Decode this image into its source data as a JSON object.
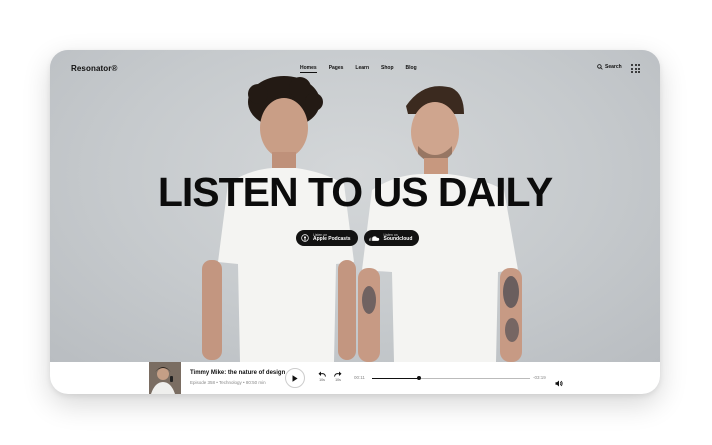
{
  "header": {
    "logo": "Resonator®",
    "nav": [
      "Homes",
      "Pages",
      "Learn",
      "Shop",
      "Blog"
    ],
    "active_nav": "Homes",
    "search_label": "Search"
  },
  "hero": {
    "headline": "LISTEN TO US DAILY",
    "badges": [
      {
        "small": "Listen on",
        "big": "Apple Podcasts",
        "icon": "podcast-icon"
      },
      {
        "small": "Listen on",
        "big": "Soundcloud",
        "icon": "soundcloud-icon"
      }
    ]
  },
  "player": {
    "title": "Timmy Mike: the nature of design",
    "meta": "Episode 358 • Technology • 80:50 min",
    "rewind_label": "10s",
    "forward_label": "10s",
    "current_time": "00:11",
    "end_time": "-03:19",
    "progress": 0.3
  },
  "colors": {
    "background": "#c9cdd0",
    "text": "#111111",
    "badge": "#121212"
  }
}
